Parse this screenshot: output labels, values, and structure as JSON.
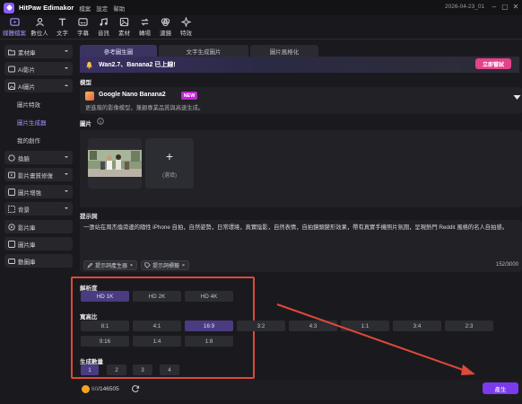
{
  "titlebar": {
    "app_name": "HitPaw Edimakor",
    "menus": [
      "檔案",
      "設定",
      "幫助"
    ],
    "build": "2026-04-23_01"
  },
  "toolbar": {
    "items": [
      {
        "label": "媒體檔案",
        "icon": "media-icon",
        "active": true
      },
      {
        "label": "數位人",
        "icon": "avatar-icon"
      },
      {
        "label": "文字",
        "icon": "text-icon"
      },
      {
        "label": "字幕",
        "icon": "subtitle-icon"
      },
      {
        "label": "音訊",
        "icon": "audio-icon"
      },
      {
        "label": "素材",
        "icon": "assets-icon"
      },
      {
        "label": "轉場",
        "icon": "transition-icon"
      },
      {
        "label": "濾鏡",
        "icon": "filter-icon"
      },
      {
        "label": "特效",
        "icon": "effects-icon"
      }
    ]
  },
  "sidebar": {
    "sections": [
      {
        "label": "素材庫",
        "icon": "folder-icon",
        "chevron": "down"
      },
      {
        "label": "AI影片",
        "icon": "ai-video-icon",
        "chevron": "down"
      },
      {
        "label": "AI圖片",
        "icon": "ai-image-icon",
        "chevron": "up"
      },
      {
        "label": "換臉",
        "icon": "face-swap-icon",
        "chevron": "down"
      },
      {
        "label": "影片畫質修復",
        "icon": "enhance-icon",
        "chevron": "down"
      },
      {
        "label": "圖片增強",
        "icon": "image-enhance-icon",
        "chevron": "down"
      },
      {
        "label": "背景",
        "icon": "background-icon",
        "chevron": "down"
      },
      {
        "label": "影片庫",
        "icon": "video-library-icon"
      },
      {
        "label": "圖片庫",
        "icon": "image-library-icon"
      },
      {
        "label": "動圖庫",
        "icon": "gif-library-icon"
      }
    ],
    "ai_image_items": [
      {
        "label": "圖片特效",
        "active": false
      },
      {
        "label": "圖片生成器",
        "active": true
      },
      {
        "label": "我的創作",
        "active": false
      }
    ]
  },
  "tabs": [
    {
      "label": "參考圖生圖",
      "active": true
    },
    {
      "label": "文字生成圖片",
      "active": false
    },
    {
      "label": "圖片風格化",
      "active": false
    }
  ],
  "banner": {
    "text": "Wan2.7、Banana2 已上線!",
    "button": "立即嘗試"
  },
  "model": {
    "section_label": "模型",
    "name": "Google Nano Banana2",
    "badge": "NEW",
    "description": "更進階的影像模型，兼顧專業品質與高速生成。"
  },
  "images": {
    "section_label": "圖片",
    "add_label": "(選填)"
  },
  "prompt": {
    "section_label": "提示詞",
    "text": "一張站在周杰倫旁邊的隨性 iPhone 自拍，自然姿勢，日常環境，真實陰影，自然表情，自拍鏡頭變形效果，帶有真實手機照片氛圍，呈現熱門 Reddit 風格的名人自拍感。",
    "generator_button": "提示詞產生器",
    "tags_button": "提示詞標籤",
    "count": "152/3000"
  },
  "resolution": {
    "label": "解析度",
    "options": [
      "HD 1K",
      "HD 2K",
      "HD 4K"
    ],
    "selected": "HD 1K"
  },
  "aspect_ratio": {
    "label": "寬高比",
    "options": [
      "8:1",
      "4:1",
      "16:9",
      "3:2",
      "4:3",
      "1:1",
      "3:4",
      "2:3",
      "9:16",
      "1:4",
      "1:8"
    ],
    "selected": "16:9"
  },
  "count_group": {
    "label": "生成數量",
    "options": [
      "1",
      "2",
      "3",
      "4"
    ],
    "selected": "1"
  },
  "footer": {
    "credits_used": "60",
    "credits_total": "/146505",
    "generate_button": "產生"
  },
  "colors": {
    "accent": "#7c3aed",
    "highlight_box": "#e0483a",
    "banner_button": "#e4428c"
  }
}
